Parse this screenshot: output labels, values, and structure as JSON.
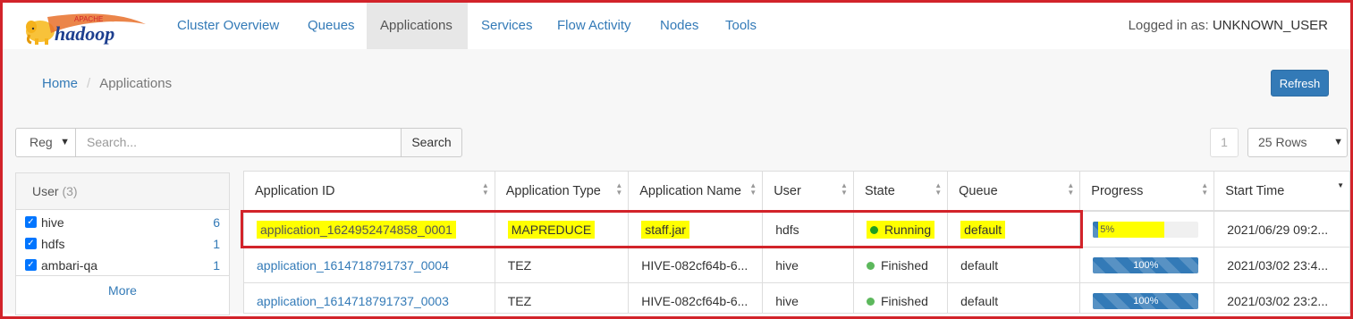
{
  "brand": {
    "top": "APACHE",
    "name": "hadoop"
  },
  "nav": {
    "items": [
      {
        "label": "Cluster Overview"
      },
      {
        "label": "Queues"
      },
      {
        "label": "Applications",
        "active": true
      },
      {
        "label": "Services"
      },
      {
        "label": "Flow Activity"
      },
      {
        "label": "Nodes"
      },
      {
        "label": "Tools"
      }
    ],
    "login_prefix": "Logged in as:",
    "login_user": "UNKNOWN_USER"
  },
  "breadcrumb": {
    "home": "Home",
    "separator": "/",
    "current": "Applications"
  },
  "toolbar": {
    "refresh_label": "Refresh"
  },
  "search": {
    "mode_value": "Reg",
    "placeholder": "Search...",
    "button_label": "Search",
    "page_number": "1",
    "rows_value": "25 Rows"
  },
  "filter": {
    "title": "User",
    "count": "(3)",
    "items": [
      {
        "label": "hive",
        "count": "6",
        "checked": true
      },
      {
        "label": "hdfs",
        "count": "1",
        "checked": true
      },
      {
        "label": "ambari-qa",
        "count": "1",
        "checked": true
      }
    ],
    "more_label": "More"
  },
  "table": {
    "columns": [
      "Application ID",
      "Application Type",
      "Application Name",
      "User",
      "State",
      "Queue",
      "Progress",
      "Start Time"
    ],
    "rows": [
      {
        "id": "application_1624952474858_0001",
        "type": "MAPREDUCE",
        "name": "staff.jar",
        "user": "hdfs",
        "state": "Running",
        "queue": "default",
        "progress": 5,
        "progress_label": "5%",
        "start": "2021/06/29 09:2..."
      },
      {
        "id": "application_1614718791737_0004",
        "type": "TEZ",
        "name": "HIVE-082cf64b-6...",
        "user": "hive",
        "state": "Finished",
        "queue": "default",
        "progress": 100,
        "progress_label": "100%",
        "start": "2021/03/02 23:4..."
      },
      {
        "id": "application_1614718791737_0003",
        "type": "TEZ",
        "name": "HIVE-082cf64b-6...",
        "user": "hive",
        "state": "Finished",
        "queue": "default",
        "progress": 100,
        "progress_label": "100%",
        "start": "2021/03/02 23:2..."
      }
    ]
  },
  "colors": {
    "link": "#337ab7",
    "highlight": "#ffff00",
    "annotation": "#d2232a",
    "running": "#1f9d1f",
    "finished": "#5cb85c"
  }
}
